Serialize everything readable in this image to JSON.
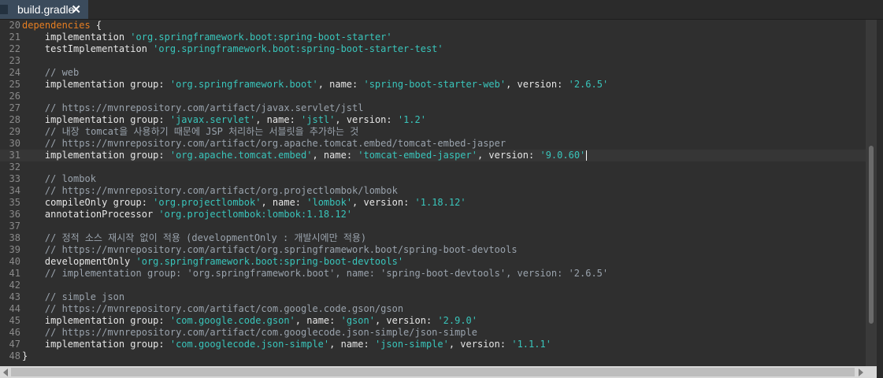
{
  "tab": {
    "title": "build.gradle",
    "close_glyph": "✕",
    "close_icon": "close-icon"
  },
  "editor": {
    "current_line": 31,
    "lines": [
      {
        "n": "20",
        "segs": [
          {
            "t": "kw",
            "v": "dependencies"
          },
          {
            "t": "p",
            "v": " {"
          }
        ]
      },
      {
        "n": "21",
        "segs": [
          {
            "t": "p",
            "v": "    implementation "
          },
          {
            "t": "str",
            "v": "'org.springframework.boot:spring-boot-starter'"
          }
        ]
      },
      {
        "n": "22",
        "segs": [
          {
            "t": "p",
            "v": "    testImplementation "
          },
          {
            "t": "str",
            "v": "'org.springframework.boot:spring-boot-starter-test'"
          }
        ]
      },
      {
        "n": "23",
        "segs": []
      },
      {
        "n": "24",
        "segs": [
          {
            "t": "cmt",
            "v": "    // web"
          }
        ]
      },
      {
        "n": "25",
        "segs": [
          {
            "t": "p",
            "v": "    implementation group: "
          },
          {
            "t": "str",
            "v": "'org.springframework.boot'"
          },
          {
            "t": "p",
            "v": ", name: "
          },
          {
            "t": "str",
            "v": "'spring-boot-starter-web'"
          },
          {
            "t": "p",
            "v": ", version: "
          },
          {
            "t": "str",
            "v": "'2.6.5'"
          }
        ]
      },
      {
        "n": "26",
        "segs": []
      },
      {
        "n": "27",
        "segs": [
          {
            "t": "cmt",
            "v": "    // https://mvnrepository.com/artifact/javax.servlet/jstl"
          }
        ]
      },
      {
        "n": "28",
        "segs": [
          {
            "t": "p",
            "v": "    implementation group: "
          },
          {
            "t": "str",
            "v": "'javax.servlet'"
          },
          {
            "t": "p",
            "v": ", name: "
          },
          {
            "t": "str",
            "v": "'jstl'"
          },
          {
            "t": "p",
            "v": ", version: "
          },
          {
            "t": "str",
            "v": "'1.2'"
          }
        ]
      },
      {
        "n": "29",
        "segs": [
          {
            "t": "cmt",
            "v": "    // 내장 tomcat을 사용하기 때문에 JSP 처리하는 서블릿을 추가하는 것"
          }
        ]
      },
      {
        "n": "30",
        "segs": [
          {
            "t": "cmt",
            "v": "    // https://mvnrepository.com/artifact/org.apache.tomcat.embed/tomcat-embed-jasper"
          }
        ]
      },
      {
        "n": "31",
        "segs": [
          {
            "t": "p",
            "v": "    implementation group: "
          },
          {
            "t": "str",
            "v": "'org.apache.tomcat.embed'"
          },
          {
            "t": "p",
            "v": ", name: "
          },
          {
            "t": "str",
            "v": "'tomcat-embed-jasper'"
          },
          {
            "t": "p",
            "v": ", version: "
          },
          {
            "t": "str",
            "v": "'9.0.60'"
          }
        ]
      },
      {
        "n": "32",
        "segs": []
      },
      {
        "n": "33",
        "segs": [
          {
            "t": "cmt",
            "v": "    // lombok"
          }
        ]
      },
      {
        "n": "34",
        "segs": [
          {
            "t": "cmt",
            "v": "    // https://mvnrepository.com/artifact/org.projectlombok/lombok"
          }
        ]
      },
      {
        "n": "35",
        "segs": [
          {
            "t": "p",
            "v": "    compileOnly group: "
          },
          {
            "t": "str",
            "v": "'org.projectlombok'"
          },
          {
            "t": "p",
            "v": ", name: "
          },
          {
            "t": "str",
            "v": "'lombok'"
          },
          {
            "t": "p",
            "v": ", version: "
          },
          {
            "t": "str",
            "v": "'1.18.12'"
          }
        ]
      },
      {
        "n": "36",
        "segs": [
          {
            "t": "p",
            "v": "    annotationProcessor "
          },
          {
            "t": "str",
            "v": "'org.projectlombok:lombok:1.18.12'"
          }
        ]
      },
      {
        "n": "37",
        "segs": []
      },
      {
        "n": "38",
        "segs": [
          {
            "t": "cmt",
            "v": "    // 정적 소스 재시작 없이 적용 (developmentOnly : 개발시에만 적용)"
          }
        ]
      },
      {
        "n": "39",
        "segs": [
          {
            "t": "cmt",
            "v": "    // https://mvnrepository.com/artifact/org.springframework.boot/spring-boot-devtools"
          }
        ]
      },
      {
        "n": "40",
        "segs": [
          {
            "t": "p",
            "v": "    developmentOnly "
          },
          {
            "t": "str",
            "v": "'org.springframework.boot:spring-boot-devtools'"
          }
        ]
      },
      {
        "n": "41",
        "segs": [
          {
            "t": "cmt",
            "v": "    // implementation group: 'org.springframework.boot', name: 'spring-boot-devtools', version: '2.6.5'"
          }
        ]
      },
      {
        "n": "42",
        "segs": []
      },
      {
        "n": "43",
        "segs": [
          {
            "t": "cmt",
            "v": "    // simple json"
          }
        ]
      },
      {
        "n": "44",
        "segs": [
          {
            "t": "cmt",
            "v": "    // https://mvnrepository.com/artifact/com.google.code.gson/gson"
          }
        ]
      },
      {
        "n": "45",
        "segs": [
          {
            "t": "p",
            "v": "    implementation group: "
          },
          {
            "t": "str",
            "v": "'com.google.code.gson'"
          },
          {
            "t": "p",
            "v": ", name: "
          },
          {
            "t": "str",
            "v": "'gson'"
          },
          {
            "t": "p",
            "v": ", version: "
          },
          {
            "t": "str",
            "v": "'2.9.0'"
          }
        ]
      },
      {
        "n": "46",
        "segs": [
          {
            "t": "cmt",
            "v": "    // https://mvnrepository.com/artifact/com.googlecode.json-simple/json-simple"
          }
        ]
      },
      {
        "n": "47",
        "segs": [
          {
            "t": "p",
            "v": "    implementation group: "
          },
          {
            "t": "str",
            "v": "'com.googlecode.json-simple'"
          },
          {
            "t": "p",
            "v": ", name: "
          },
          {
            "t": "str",
            "v": "'json-simple'"
          },
          {
            "t": "p",
            "v": ", version: "
          },
          {
            "t": "str",
            "v": "'1.1.1'"
          }
        ]
      },
      {
        "n": "48",
        "segs": [
          {
            "t": "p",
            "v": "}"
          }
        ]
      }
    ]
  },
  "colors": {
    "keyword": "#e67e22",
    "string": "#39c5bb",
    "comment": "#9aa3ad",
    "plain": "#e6e6e6",
    "background": "#2f2f2f",
    "tab": "#3b4b5c"
  },
  "scrollbars": {
    "vertical_icon": "vertical-scrollbar",
    "horizontal_icon": "horizontal-scrollbar"
  }
}
